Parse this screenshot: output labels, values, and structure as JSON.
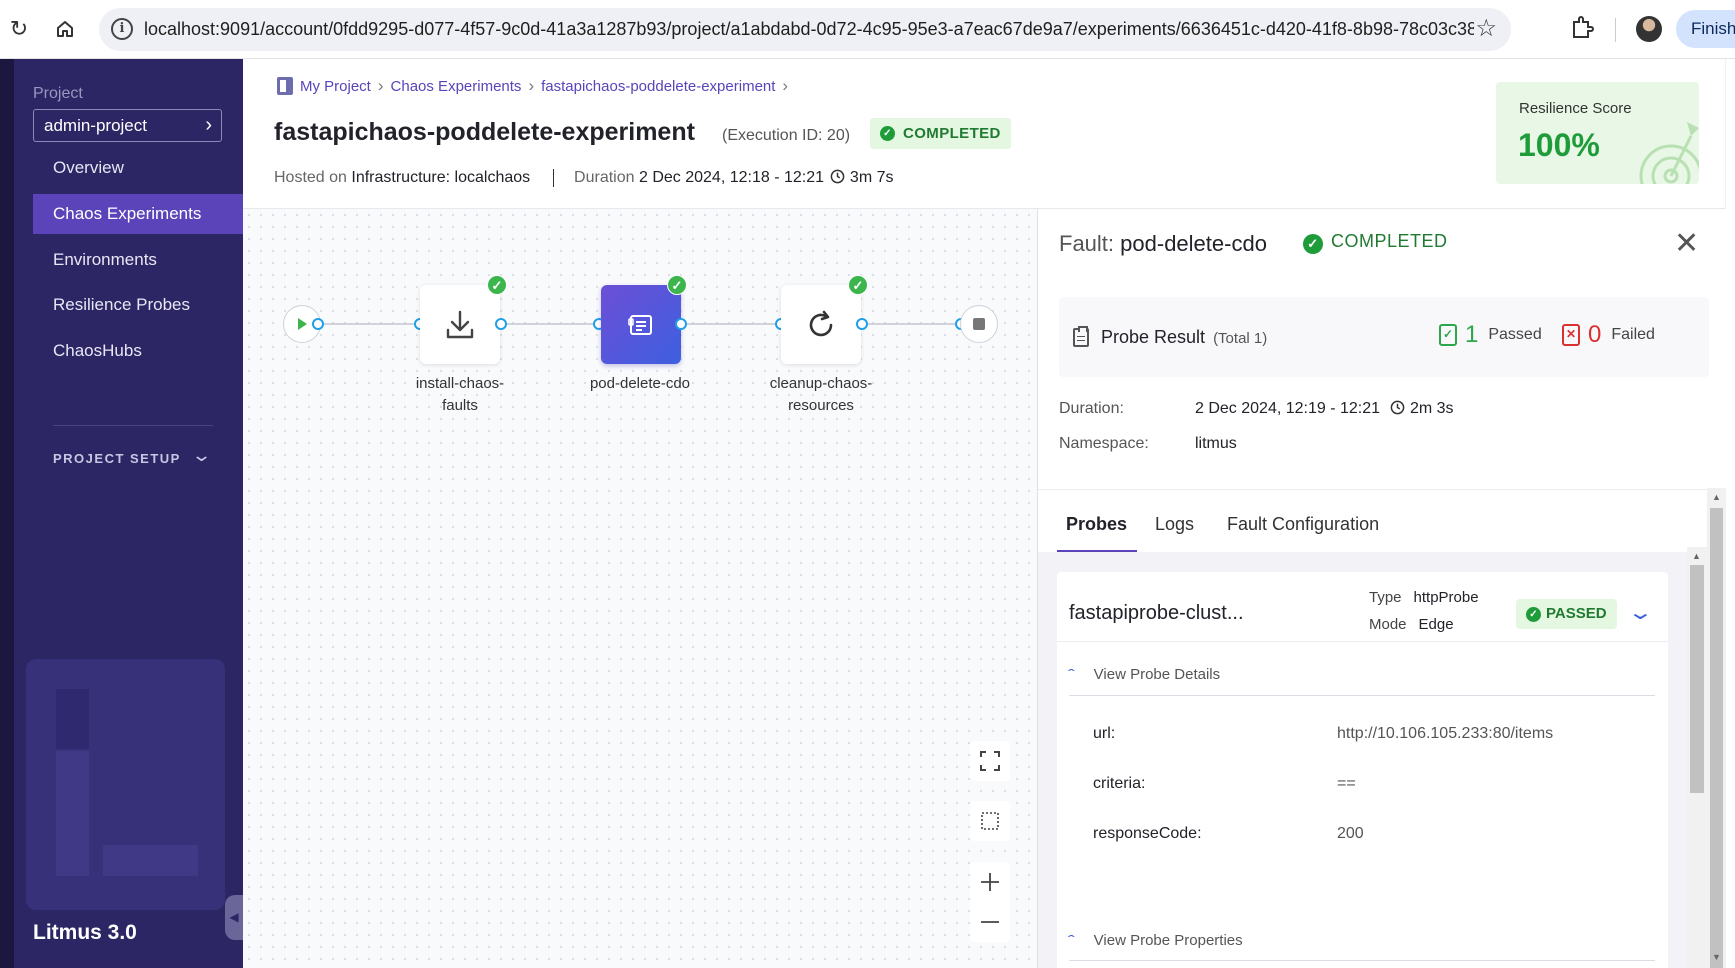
{
  "browser": {
    "url": "localhost:9091/account/0fdd9295-d077-4f57-9c0d-41a3a1287b93/project/a1abdabd-0d72-4c95-95e3-a7eac67de9a7/experiments/6636451c-d420-41f8-8b98-78c03c38ac22...",
    "finish_label": "Finish",
    "icons": [
      "reload-icon",
      "home-icon",
      "info-icon",
      "star-icon",
      "extensions-icon",
      "profile-avatar"
    ]
  },
  "sidebar": {
    "project_label": "Project",
    "project_name": "admin-project",
    "nav": [
      {
        "label": "Overview",
        "active": false
      },
      {
        "label": "Chaos Experiments",
        "active": true
      },
      {
        "label": "Environments",
        "active": false
      },
      {
        "label": "Resilience Probes",
        "active": false
      },
      {
        "label": "ChaosHubs",
        "active": false
      }
    ],
    "setup_label": "PROJECT SETUP",
    "version": "Litmus 3.0"
  },
  "header": {
    "breadcrumbs": [
      "My Project",
      "Chaos Experiments",
      "fastapichaos-poddelete-experiment"
    ],
    "title": "fastapichaos-poddelete-experiment",
    "execution_id": "(Execution ID: 20)",
    "status": "COMPLETED",
    "hosted_label": "Hosted on",
    "infrastructure": "Infrastructure: localchaos",
    "duration_label": "Duration",
    "duration_range": "2 Dec 2024, 12:18 - 12:21",
    "duration_total": "3m 7s",
    "resilience_label": "Resilience Score",
    "resilience_value": "100%"
  },
  "workflow": {
    "nodes": [
      {
        "label": "install-chaos-faults",
        "status": "succeeded",
        "icon": "download-icon"
      },
      {
        "label": "pod-delete-cdo",
        "status": "succeeded",
        "icon": "fault-icon",
        "selected": true
      },
      {
        "label": "cleanup-chaos-resources",
        "status": "succeeded",
        "icon": "refresh-icon"
      }
    ],
    "controls": [
      "fit-to-screen-icon",
      "select-area-icon",
      "zoom-in-icon",
      "zoom-out-icon"
    ]
  },
  "panel": {
    "fault_prefix": "Fault:",
    "fault_name": "pod-delete-cdo",
    "fault_status": "COMPLETED",
    "probe_result_label": "Probe Result",
    "probe_total": "(Total 1)",
    "passed_count": "1",
    "passed_label": "Passed",
    "failed_count": "0",
    "failed_label": "Failed",
    "duration_label": "Duration:",
    "duration_value": "2 Dec 2024, 12:19 - 12:21",
    "duration_total": "2m 3s",
    "namespace_label": "Namespace:",
    "namespace_value": "litmus",
    "tabs": [
      {
        "label": "Probes",
        "active": true
      },
      {
        "label": "Logs",
        "active": false
      },
      {
        "label": "Fault Configuration",
        "active": false
      }
    ],
    "probe": {
      "name": "fastapiprobe-clust...",
      "type_label": "Type",
      "type_value": "httpProbe",
      "mode_label": "Mode",
      "mode_value": "Edge",
      "status": "PASSED",
      "details_label": "View Probe Details",
      "details": [
        {
          "key": "url:",
          "value": "http://10.106.105.233:80/items"
        },
        {
          "key": "criteria:",
          "value": "=="
        },
        {
          "key": "responseCode:",
          "value": "200"
        }
      ],
      "properties_label": "View Probe Properties"
    }
  },
  "colors": {
    "sidebar": "#2c2664",
    "accent": "#5b44ba",
    "success": "#1e9c3a",
    "danger": "#d93030"
  }
}
